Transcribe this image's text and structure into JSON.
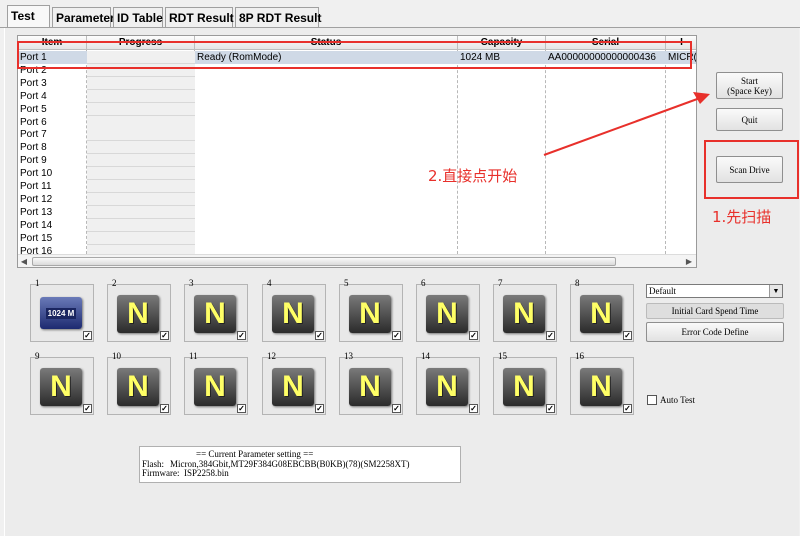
{
  "tabs": [
    "Test",
    "Parameter",
    "ID Table",
    "RDT Result",
    "8P RDT Result"
  ],
  "list": {
    "columns": [
      "Item",
      "Progress",
      "Status",
      "Capacity",
      "Serial",
      "I"
    ],
    "rows": [
      {
        "item": "Port 1",
        "status": "Ready (RomMode)",
        "capacity": "1024 MB",
        "serial": "AA00000000000000436",
        "extra": "MICR("
      },
      {
        "item": "Port 2"
      },
      {
        "item": "Port 3"
      },
      {
        "item": "Port 4"
      },
      {
        "item": "Port 5"
      },
      {
        "item": "Port 6"
      },
      {
        "item": "Port 7"
      },
      {
        "item": "Port 8"
      },
      {
        "item": "Port 9"
      },
      {
        "item": "Port 10"
      },
      {
        "item": "Port 11"
      },
      {
        "item": "Port 12"
      },
      {
        "item": "Port 13"
      },
      {
        "item": "Port 14"
      },
      {
        "item": "Port 15"
      },
      {
        "item": "Port 16"
      }
    ]
  },
  "buttons": {
    "start_line1": "Start",
    "start_line2": "(Space Key)",
    "quit": "Quit",
    "scan": "Scan Drive",
    "initial": "Initial Card Spend Time",
    "error": "Error Code Define"
  },
  "select_value": "Default",
  "auto_test": "Auto Test",
  "slots": {
    "card_label": "1024 M",
    "n_letter": "N",
    "numbers": [
      "1",
      "2",
      "3",
      "4",
      "5",
      "6",
      "7",
      "8",
      "9",
      "10",
      "11",
      "12",
      "13",
      "14",
      "15",
      "16"
    ]
  },
  "param": {
    "title": "== Current Parameter setting ==",
    "flash_label": "Flash:",
    "flash_value": "Micron,384Gbit,MT29F384G08EBCBB(B0KB)(78)(SM2258XT)",
    "firmware_label": "Firmware:",
    "firmware_value": "ISP2258.bin"
  },
  "annotations": {
    "step1": "1.先扫描",
    "step2": "2.直接点开始"
  },
  "colors": {
    "annotation": "#e8302b",
    "selected_row": "#cfd9e6"
  }
}
